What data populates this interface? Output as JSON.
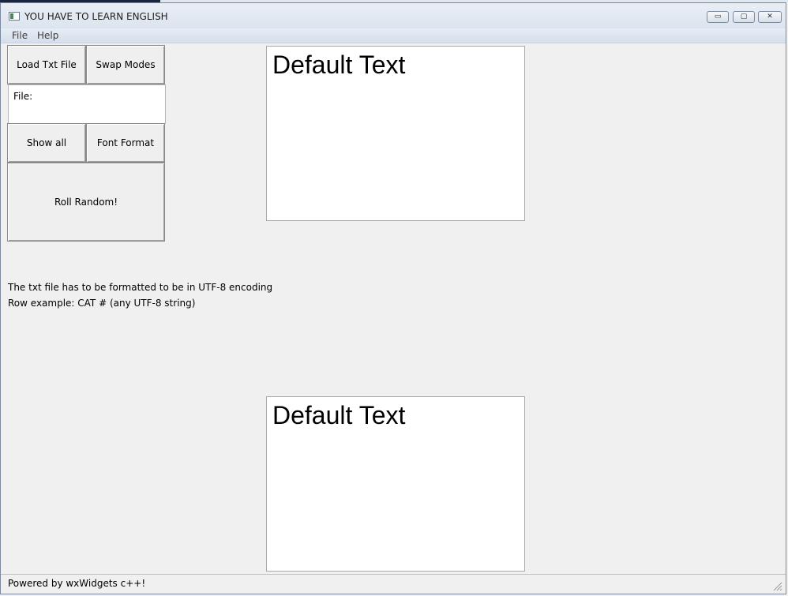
{
  "window": {
    "title": "YOU HAVE TO LEARN ENGLISH",
    "controls": {
      "minimize": "▭",
      "maximize": "▢",
      "close": "✕"
    }
  },
  "menu": {
    "items": [
      {
        "label": "File"
      },
      {
        "label": "Help"
      }
    ]
  },
  "buttons": {
    "load": "Load Txt File",
    "swap": "Swap Modes",
    "show_all": "Show all",
    "font_format": "Font Format",
    "roll": "Roll Random!"
  },
  "file": {
    "label": "File:"
  },
  "info": {
    "line1": "The txt file has to be formatted to be in UTF-8 encoding",
    "line2": "Row example: CAT # (any UTF-8 string)"
  },
  "panels": {
    "top_text": "Default Text",
    "bottom_text": "Default Text"
  },
  "status": {
    "text": "Powered by wxWidgets c++!"
  }
}
